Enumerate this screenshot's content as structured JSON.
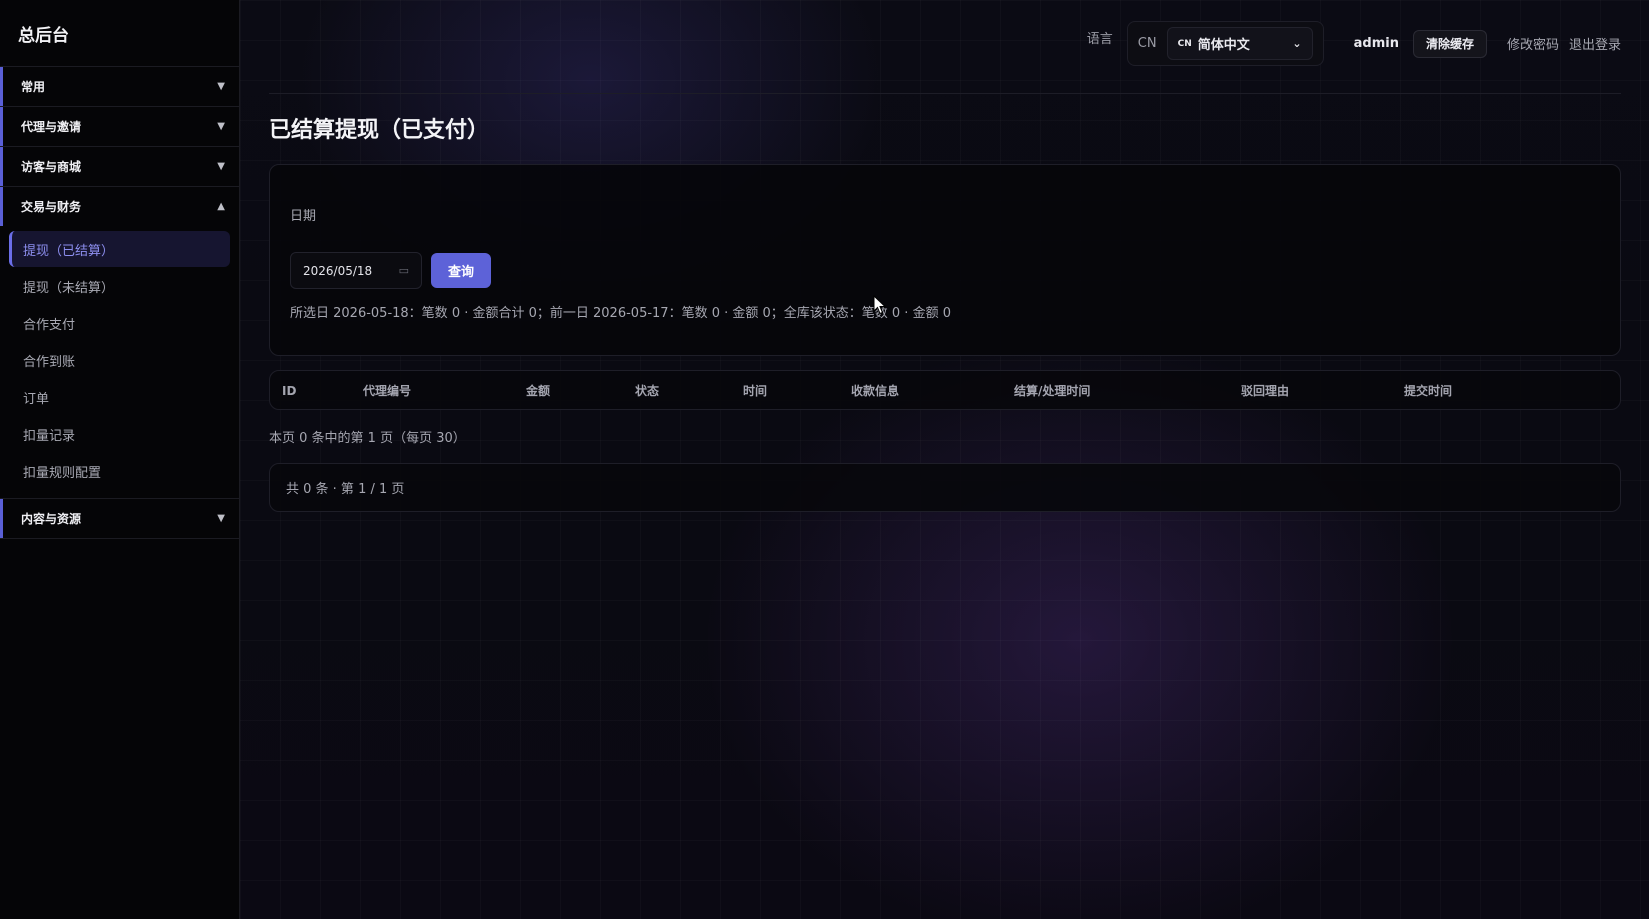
{
  "app": {
    "brand": "总后台"
  },
  "sidebar": {
    "groups": [
      {
        "label": "常用",
        "expanded": false
      },
      {
        "label": "代理与邀请",
        "expanded": false
      },
      {
        "label": "访客与商城",
        "expanded": false
      },
      {
        "label": "交易与财务",
        "expanded": true,
        "items": [
          {
            "label": "提现（已结算）",
            "active": true
          },
          {
            "label": "提现（未结算）"
          },
          {
            "label": "合作支付"
          },
          {
            "label": "合作到账"
          },
          {
            "label": "订单"
          },
          {
            "label": "扣量记录"
          },
          {
            "label": "扣量规则配置"
          }
        ]
      },
      {
        "label": "内容与资源",
        "expanded": false
      }
    ]
  },
  "topbar": {
    "language_label": "语言",
    "language_code": "CN",
    "language_flag": "CN",
    "language_selected": "简体中文",
    "user": "admin",
    "clear_cache": "清除缓存",
    "change_password": "修改密码",
    "logout": "退出登录"
  },
  "page": {
    "title": "已结算提现（已支付）",
    "filter": {
      "date_label": "日期",
      "date_value": "2026/05/18",
      "query_button": "查询",
      "summary": "所选日 2026-05-18：笔数 0 · 金额合计 0；前一日 2026-05-17：笔数 0 · 金额 0；全库该状态：笔数 0 · 金额 0"
    },
    "table": {
      "columns": [
        "ID",
        "代理编号",
        "金额",
        "状态",
        "时间",
        "收款信息",
        "结算/处理时间",
        "驳回理由",
        "提交时间"
      ],
      "rows": []
    },
    "page_info": "本页 0 条中的第 1 页（每页 30）",
    "pager_text": "共 0 条 · 第 1 / 1 页"
  },
  "colors": {
    "accent": "#5d62d8",
    "active_nav_text": "#8d8ff0",
    "sidebar_bg": "#050507"
  }
}
